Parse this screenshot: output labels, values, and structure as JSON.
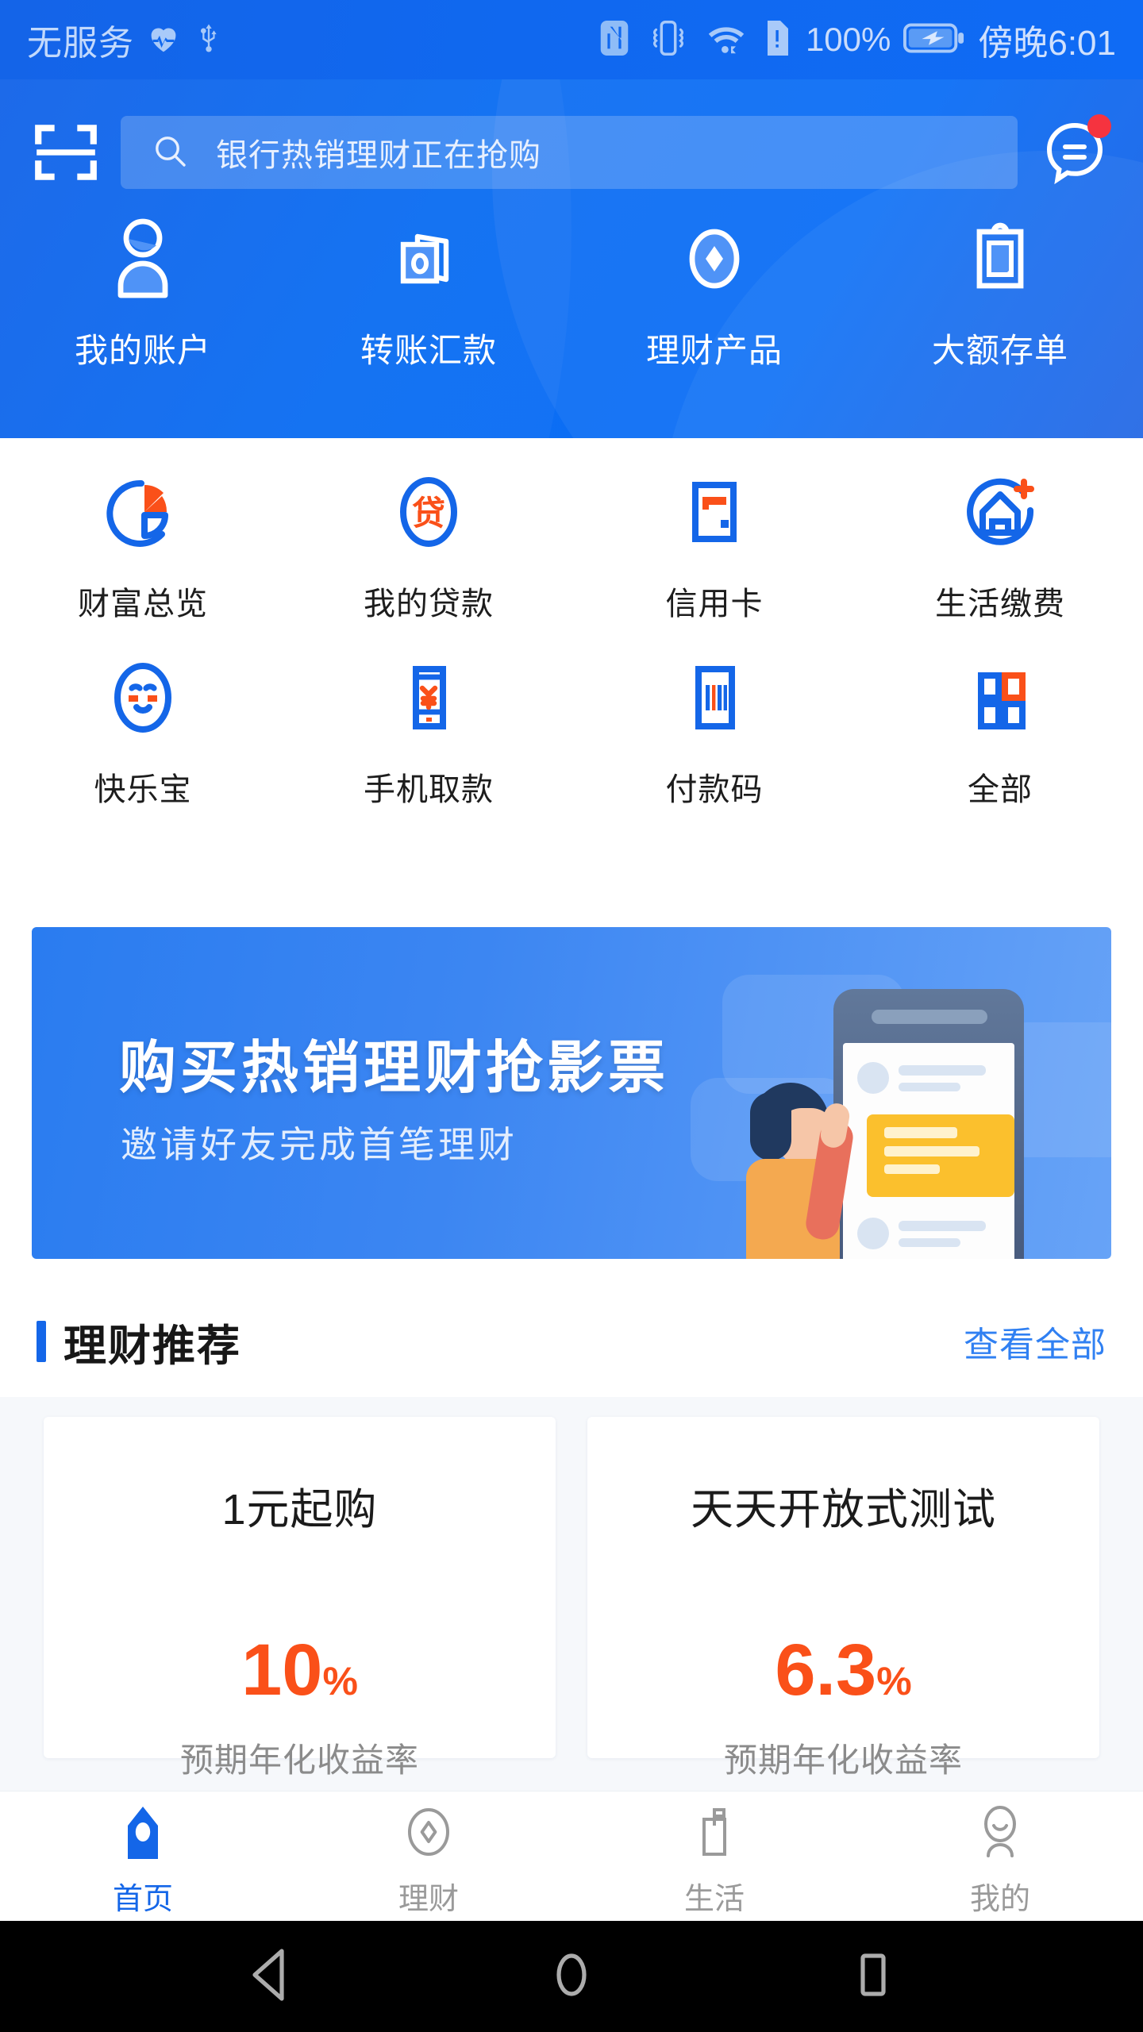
{
  "status_bar": {
    "carrier": "无服务",
    "battery_percent": "100%",
    "time": "傍晚6:01",
    "icons": [
      "heart-rate-icon",
      "usb-icon",
      "nfc-icon",
      "vibrate-icon",
      "wifi-icon",
      "sim-alert-icon",
      "battery-charging-icon"
    ]
  },
  "header": {
    "scan_icon": "scan-icon",
    "search": {
      "placeholder": "银行热销理财正在抢购",
      "icon": "search-icon"
    },
    "message_icon": "message-icon",
    "message_badge": "",
    "actions": [
      {
        "label": "我的账户",
        "icon": "person-icon"
      },
      {
        "label": "转账汇款",
        "icon": "transfer-icon"
      },
      {
        "label": "理财产品",
        "icon": "diamond-circle-icon"
      },
      {
        "label": "大额存单",
        "icon": "clipboard-icon"
      }
    ]
  },
  "quick_grid": {
    "row1": [
      {
        "label": "财富总览",
        "icon": "pie-chart-icon"
      },
      {
        "label": "我的贷款",
        "icon": "loan-icon"
      },
      {
        "label": "信用卡",
        "icon": "credit-card-icon"
      },
      {
        "label": "生活缴费",
        "icon": "house-plus-icon"
      }
    ],
    "row2": [
      {
        "label": "快乐宝",
        "icon": "smiley-icon"
      },
      {
        "label": "手机取款",
        "icon": "phone-cash-icon"
      },
      {
        "label": "付款码",
        "icon": "barcode-icon"
      },
      {
        "label": "全部",
        "icon": "grid-all-icon"
      }
    ]
  },
  "banner": {
    "title": "购买热销理财抢影票",
    "subtitle": "邀请好友完成首笔理财"
  },
  "section": {
    "title": "理财推荐",
    "more_label": "查看全部"
  },
  "products": [
    {
      "title": "1元起购",
      "rate_number": "10",
      "rate_unit": "%",
      "desc": "预期年化收益率"
    },
    {
      "title": "天天开放式测试",
      "rate_number": "6.3",
      "rate_unit": "%",
      "desc": "预期年化收益率"
    }
  ],
  "tabs": [
    {
      "label": "首页",
      "icon": "home-icon",
      "active": true
    },
    {
      "label": "理财",
      "icon": "finance-icon",
      "active": false
    },
    {
      "label": "生活",
      "icon": "life-icon",
      "active": false
    },
    {
      "label": "我的",
      "icon": "profile-icon",
      "active": false
    }
  ],
  "android_nav": [
    {
      "name": "back-button",
      "icon": "triangle-back-icon"
    },
    {
      "name": "home-button",
      "icon": "circle-home-icon"
    },
    {
      "name": "recents-button",
      "icon": "square-recents-icon"
    }
  ],
  "colors": {
    "brand_blue": "#1466e8",
    "accent_orange": "#fa5019",
    "badge_red": "#f5333f",
    "muted_gray": "#9a9a9a"
  }
}
